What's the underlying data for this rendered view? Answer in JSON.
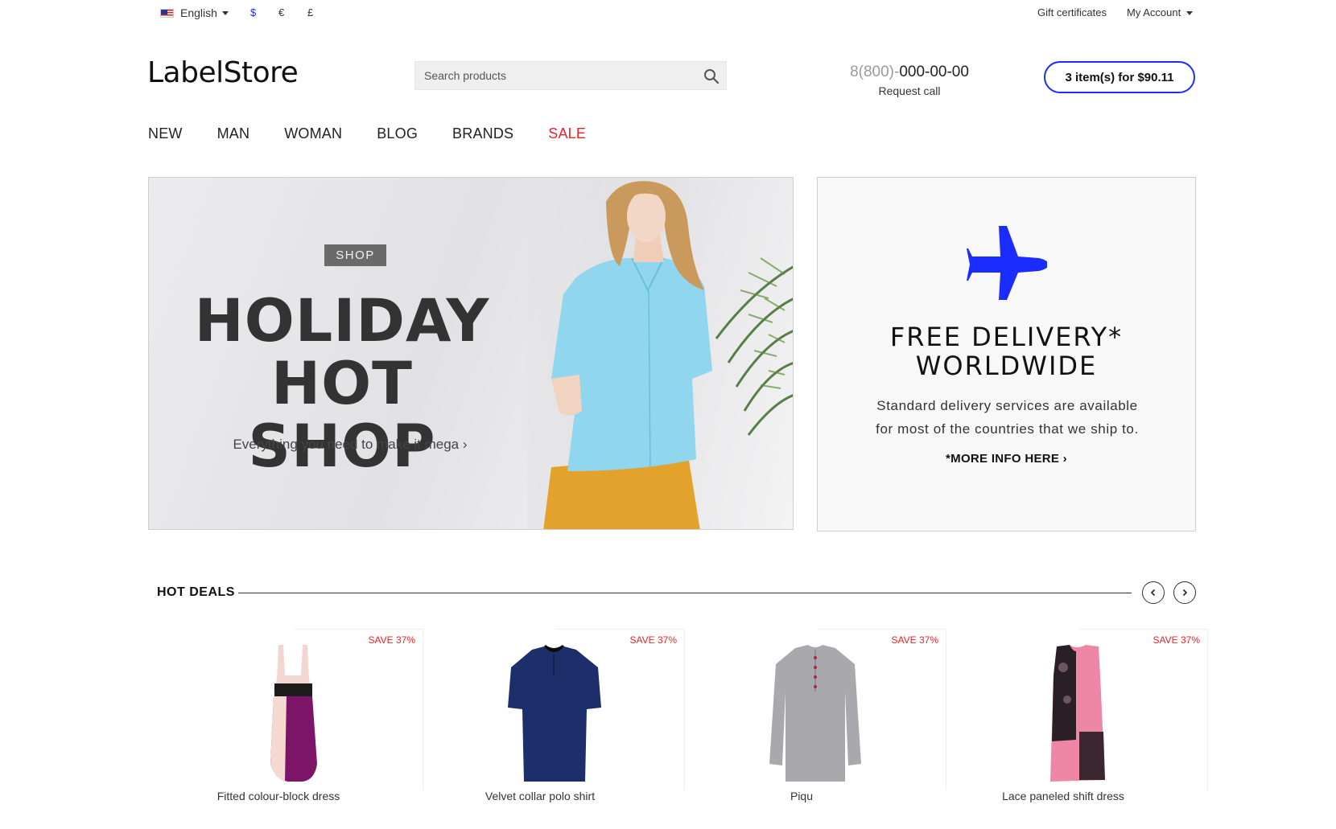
{
  "topbar": {
    "language": "English",
    "currencies": [
      "$",
      "€",
      "£"
    ],
    "gift_certificates": "Gift certificates",
    "my_account": "My Account"
  },
  "header": {
    "logo": "LabelStore",
    "search_placeholder": "Search products",
    "phone_prefix": "8(800)-",
    "phone_number": "000-00-00",
    "request_call": "Request call",
    "cart_label": "3 item(s) for $90.11"
  },
  "nav": {
    "items": [
      "NEW",
      "MAN",
      "WOMAN",
      "BLOG",
      "BRANDS",
      "SALE"
    ]
  },
  "hero": {
    "tag": "SHOP",
    "title_line1": "HOLIDAY",
    "title_line2": "HOT SHOP",
    "subtitle": "Everything you need to make it mega ›"
  },
  "delivery": {
    "title_line1": "FREE DELIVERY*",
    "title_line2": "WORLDWIDE",
    "text_line1": "Standard delivery services are available",
    "text_line2": "for most of the countries that we ship to.",
    "link": "*MORE INFO HERE ›"
  },
  "deals": {
    "heading": "HOT DEALS",
    "products": [
      {
        "name": "Fitted colour-block dress",
        "badge": "SAVE 37%"
      },
      {
        "name": "Velvet collar polo shirt",
        "badge": "SAVE 37%"
      },
      {
        "name": "Piqu",
        "badge": "SAVE 37%"
      },
      {
        "name": "Lace paneled shift dress",
        "badge": "SAVE 37%"
      }
    ]
  },
  "colors": {
    "accent": "#1a2cff",
    "sale": "#e8252b"
  }
}
